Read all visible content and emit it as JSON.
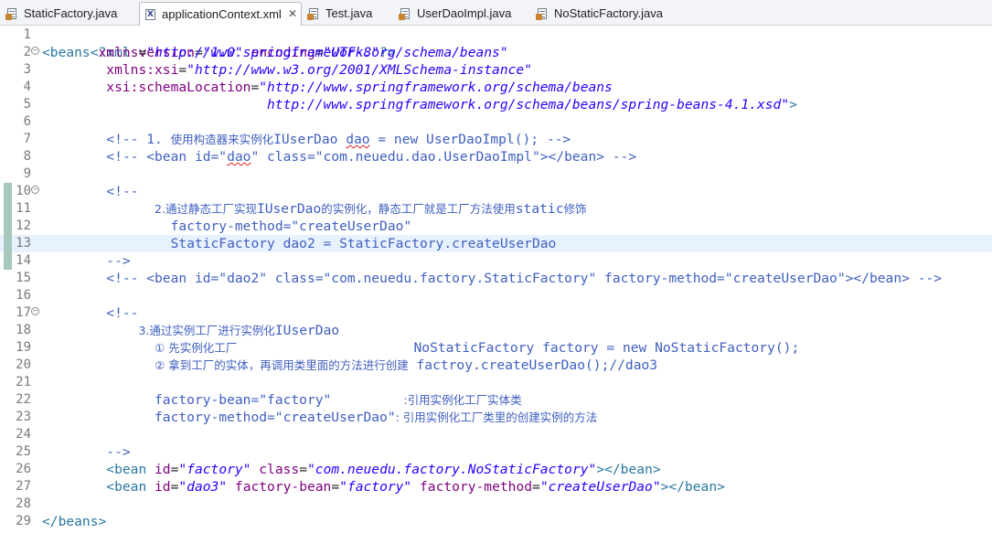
{
  "tabs": [
    {
      "label": "StaticFactory.java",
      "icon": "java-file-icon"
    },
    {
      "label": "applicationContext.xml",
      "icon": "xml-file-icon",
      "active": true,
      "close": "✕"
    },
    {
      "label": "Test.java",
      "icon": "java-file-icon"
    },
    {
      "label": "UserDaoImpl.java",
      "icon": "java-file-icon"
    },
    {
      "label": "NoStaticFactory.java",
      "icon": "java-file-icon"
    }
  ],
  "editor": {
    "line_numbers": [
      "1",
      "2",
      "3",
      "4",
      "5",
      "6",
      "7",
      "8",
      "9",
      "10",
      "11",
      "12",
      "13",
      "14",
      "15",
      "16",
      "17",
      "18",
      "19",
      "20",
      "21",
      "22",
      "23",
      "24",
      "25",
      "26",
      "27",
      "28",
      "29"
    ],
    "l1": {
      "open": "<?xml ",
      "a1": "version",
      "eq1": "=",
      "v1": "\"1.0\"",
      "sp": " ",
      "a2": "encoding",
      "eq2": "=",
      "v2": "\"UTF-8\"",
      "close": "?>"
    },
    "l2": {
      "tag": "<beans ",
      "a": "xmlns",
      "eq": "=",
      "v": "\"http://www.springframework.org/schema/beans\""
    },
    "l3": {
      "indent": "        ",
      "a": "xmlns:xsi",
      "eq": "=",
      "v": "\"http://www.w3.org/2001/XMLSchema-instance\""
    },
    "l4": {
      "indent": "        ",
      "a": "xsi:schemaLocation",
      "eq": "=",
      "v": "\"http://www.springframework.org/schema/beans"
    },
    "l5": {
      "indent": "                            ",
      "v": "http://www.springframework.org/schema/beans/spring-beans-4.1.xsd\"",
      "close": ">"
    },
    "l7": {
      "indent": "        ",
      "c1": "<!-- 1. ",
      "zh": "使用构造器来实例化",
      "c2": "IUserDao ",
      "sq": "dao",
      "c3": " = new UserDaoImpl(); -->"
    },
    "l8": {
      "indent": "        ",
      "c1": "<!-- <bean id=\"",
      "sq": "dao",
      "c2": "\" class=\"com.neuedu.dao.UserDaoImpl\"></bean> -->"
    },
    "l10": {
      "indent": "        ",
      "c": "<!--"
    },
    "l11": {
      "indent": "              ",
      "zh1": "2.通过静态工厂实现",
      "c": "IUserDao",
      "zh2": "的实例化，静态工厂就是工厂方法使用",
      "c2": "static",
      "zh3": "修饰"
    },
    "l12": {
      "indent": "                ",
      "c": "factory-method=\"createUserDao\""
    },
    "l13": {
      "indent": "                ",
      "c": "StaticFactory dao2 = StaticFactory.createUserDao"
    },
    "l14": {
      "indent": "        ",
      "c": "-->"
    },
    "l15": {
      "indent": "        ",
      "c": "<!-- <bean id=\"dao2\" class=\"com.neuedu.factory.StaticFactory\" factory-method=\"createUserDao\"></bean> -->"
    },
    "l17": {
      "indent": "        ",
      "c": "<!--"
    },
    "l18": {
      "indent": "            ",
      "zh": "3.通过实例工厂进行实例化",
      "c": "IUserDao"
    },
    "l19": {
      "indent": "              ",
      "zh": "① 先实例化工厂",
      "pad": "                      ",
      "c": "NoStaticFactory factory = new NoStaticFactory();"
    },
    "l20": {
      "indent": "              ",
      "zh": "② 拿到工厂的实体，再调用类里面的方法进行创建",
      "c": " factroy.createUserDao();//dao3"
    },
    "l22": {
      "indent": "              ",
      "c": "factory-bean=\"factory\"",
      "pad": "         ",
      "zh": ":引用实例化工厂实体类"
    },
    "l23": {
      "indent": "              ",
      "c": "factory-method=\"createUserDao\"",
      "zh": ": 引用实例化工厂类里的创建实例的方法"
    },
    "l25": {
      "indent": "        ",
      "c": "-->"
    },
    "l26": {
      "indent": "        ",
      "t1": "<bean ",
      "a1": "id",
      "eq1": "=",
      "v1": "\"factory\"",
      "sp": " ",
      "a2": "class",
      "eq2": "=",
      "v2": "\"com.neuedu.factory.NoStaticFactory\"",
      "t2": "></bean>"
    },
    "l27": {
      "indent": "        ",
      "t1": "<bean ",
      "a1": "id",
      "eq1": "=",
      "v1": "\"dao3\"",
      "sp1": " ",
      "a2": "factory-bean",
      "eq2": "=",
      "v2": "\"factory\"",
      "sp2": " ",
      "a3": "factory-method",
      "eq3": "=",
      "v3": "\"createUserDao\"",
      "t2": "></bean>"
    },
    "l29": {
      "t": "</beans>"
    }
  },
  "colors": {
    "tag": "#2a77a0",
    "attr": "#7f007f",
    "value": "#2a00ff",
    "comment": "#3f5fbf",
    "current_line": "#e8f2fe"
  }
}
